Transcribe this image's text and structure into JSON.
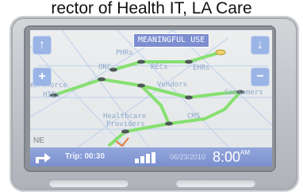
{
  "caption": "rector of Health IT, LA Care",
  "banner": "MEANINGFUL USE",
  "map_labels": {
    "phrs": "PHRs",
    "onc": "ONC",
    "recs": "RECs",
    "ehrs": "EHRs",
    "workforce": "Workforce",
    "hies": "HIEs",
    "vendors": "Vendors",
    "consumers": "Consumers",
    "healthcare": "Healthcare",
    "providers": "Providers",
    "cms": "CMS"
  },
  "direction": "NE",
  "trip": "Trip: 00:30",
  "date": "06/23/2010",
  "time": "8:00",
  "time_suffix": "AM",
  "buttons": {
    "top_left": "↑",
    "mid_left": "+",
    "top_right": "↓",
    "mid_right": "−"
  },
  "colors": {
    "route": "#7fdc6a",
    "road": "#a9c2e6",
    "bar": "#7a8fce"
  }
}
